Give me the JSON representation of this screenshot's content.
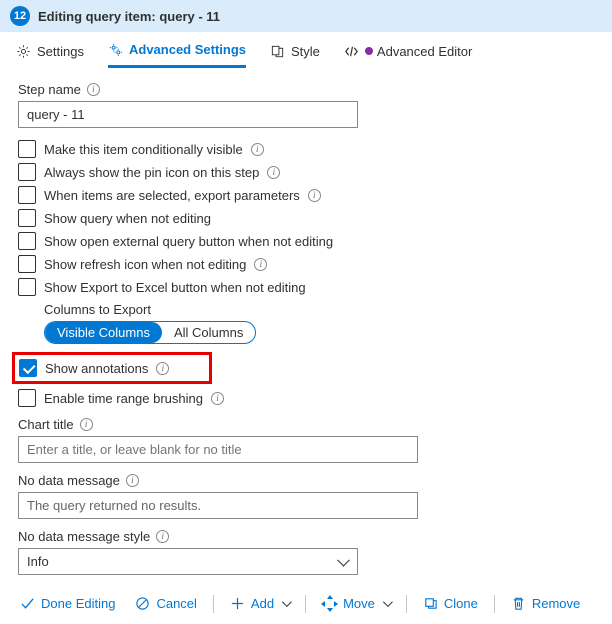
{
  "header": {
    "badge": "12",
    "title": "Editing query item: query - 11"
  },
  "tabs": {
    "settings": "Settings",
    "advanced": "Advanced Settings",
    "style": "Style",
    "advanced_editor": "Advanced Editor"
  },
  "step_name": {
    "label": "Step name",
    "value": "query - 11"
  },
  "checks": {
    "conditional": "Make this item conditionally visible",
    "pin": "Always show the pin icon on this step",
    "export_params": "When items are selected, export parameters",
    "show_query": "Show query when not editing",
    "show_external": "Show open external query button when not editing",
    "show_refresh": "Show refresh icon when not editing",
    "show_excel": "Show Export to Excel button when not editing",
    "show_annotations": "Show annotations",
    "time_brush": "Enable time range brushing"
  },
  "columns_export": {
    "label": "Columns to Export",
    "visible": "Visible Columns",
    "all": "All Columns"
  },
  "chart_title": {
    "label": "Chart title",
    "placeholder": "Enter a title, or leave blank for no title"
  },
  "no_data": {
    "label": "No data message",
    "value": "The query returned no results."
  },
  "no_data_style": {
    "label": "No data message style",
    "value": "Info"
  },
  "footer": {
    "done": "Done Editing",
    "cancel": "Cancel",
    "add": "Add",
    "move": "Move",
    "clone": "Clone",
    "remove": "Remove"
  }
}
